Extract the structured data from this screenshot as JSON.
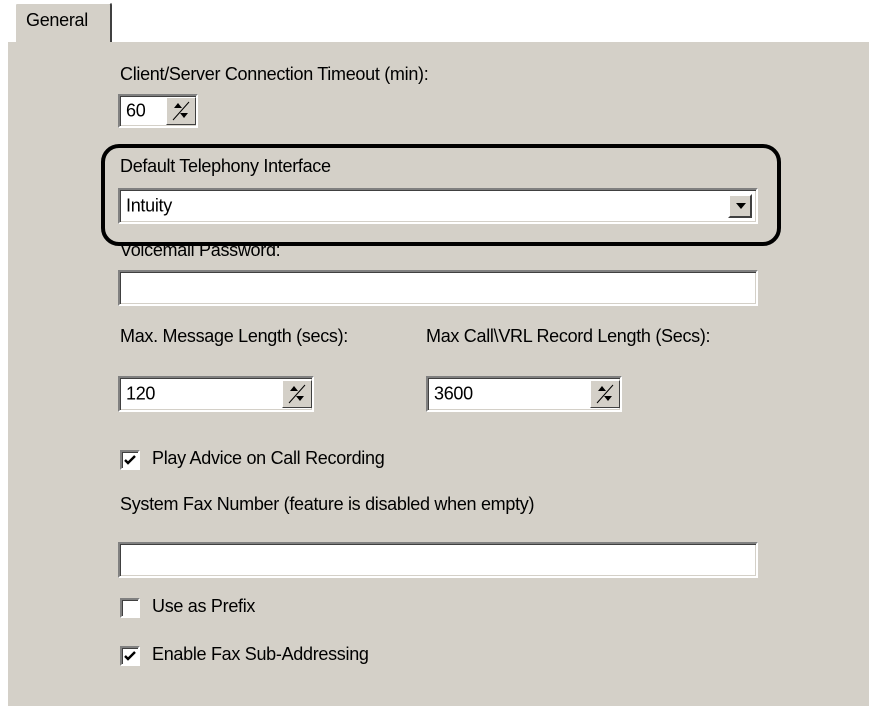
{
  "tabs": [
    {
      "label": "General"
    }
  ],
  "fields": {
    "timeout": {
      "label": "Client/Server Connection Timeout (min):",
      "value": "60"
    },
    "telephony": {
      "label": "Default Telephony Interface",
      "value": "Intuity"
    },
    "voicemail": {
      "label": "Voicemail Password:",
      "value": ""
    },
    "max_message": {
      "label": "Max. Message Length (secs):",
      "value": "120"
    },
    "max_call": {
      "label": "Max Call\\VRL Record Length (Secs):",
      "value": "3600"
    },
    "fax": {
      "label": "System Fax Number (feature is disabled when empty)",
      "value": ""
    }
  },
  "checkboxes": {
    "play_advice": {
      "label": "Play Advice on Call Recording",
      "checked": true
    },
    "use_prefix": {
      "label": "Use as Prefix",
      "checked": false
    },
    "fax_sub": {
      "label": "Enable Fax Sub-Addressing",
      "checked": true
    }
  },
  "colors": {
    "panel": "#d4d0c8",
    "field": "#ffffff",
    "highlight": "#000000"
  },
  "icons": {
    "spinner": "up-down-arrows-icon",
    "dropdown": "down-arrow-icon",
    "check": "checkmark-icon"
  }
}
